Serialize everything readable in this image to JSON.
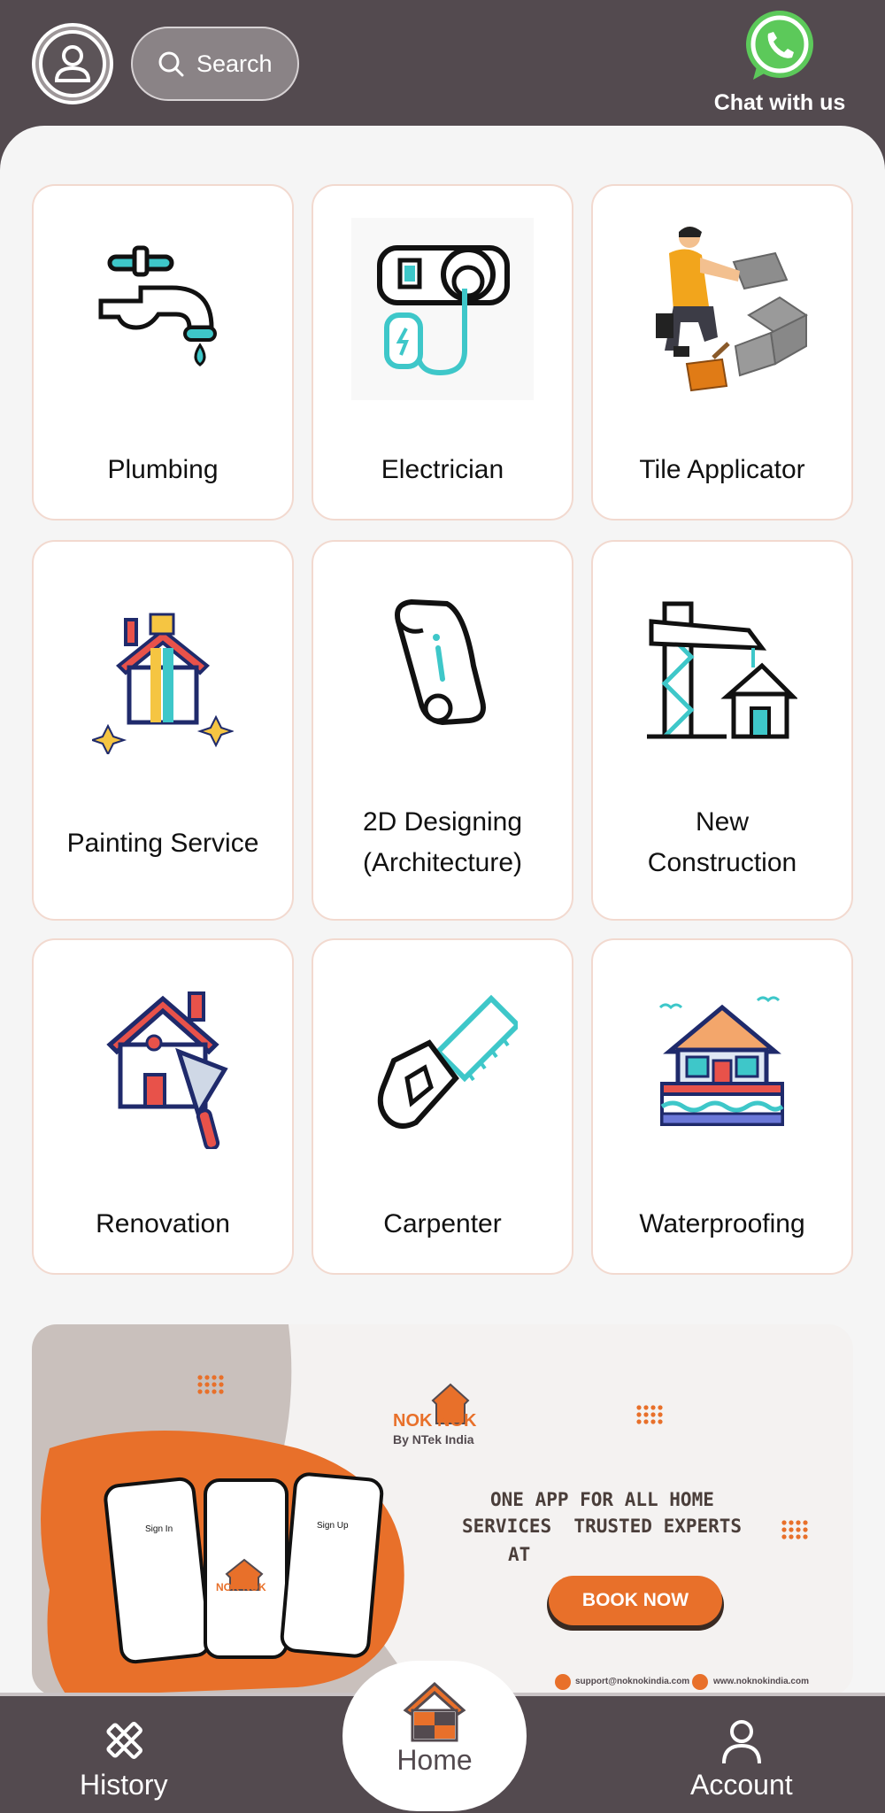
{
  "header": {
    "search_label": "Search",
    "chat_label": "Chat with us"
  },
  "services": [
    {
      "label": "Plumbing",
      "icon": "faucet-icon"
    },
    {
      "label": "Electrician",
      "icon": "socket-plug-icon"
    },
    {
      "label": "Tile Applicator",
      "icon": "tile-worker-icon"
    },
    {
      "label": "Painting Service",
      "icon": "painted-house-icon"
    },
    {
      "label": "2D Designing\n(Architecture)",
      "icon": "blueprint-roll-icon"
    },
    {
      "label": "New\nConstruction",
      "icon": "crane-house-icon"
    },
    {
      "label": "Renovation",
      "icon": "house-trowel-icon"
    },
    {
      "label": "Carpenter",
      "icon": "hand-saw-icon"
    },
    {
      "label": "Waterproofing",
      "icon": "house-on-water-icon"
    }
  ],
  "banner": {
    "brand_name": "NOK NOK",
    "brand_sub": "By NTek India",
    "headline_1": "ONE APP FOR ALL HOME",
    "headline_2": "SERVICES  TRUSTED EXPERTS",
    "headline_3": "AT",
    "cta": "BOOK NOW",
    "email": "support@noknokindia.com",
    "website": "www.noknokindia.com",
    "phone_1_title": "Sign In",
    "phone_3_title": "Sign Up",
    "phone_2_brand": "NOK NOK"
  },
  "nav": {
    "history": "History",
    "home": "Home",
    "account": "Account"
  },
  "colors": {
    "header": "#534a4f",
    "accent_orange": "#e8702a",
    "teal": "#3ec7c9",
    "navy": "#1f2a6b",
    "coral": "#e8524a"
  }
}
